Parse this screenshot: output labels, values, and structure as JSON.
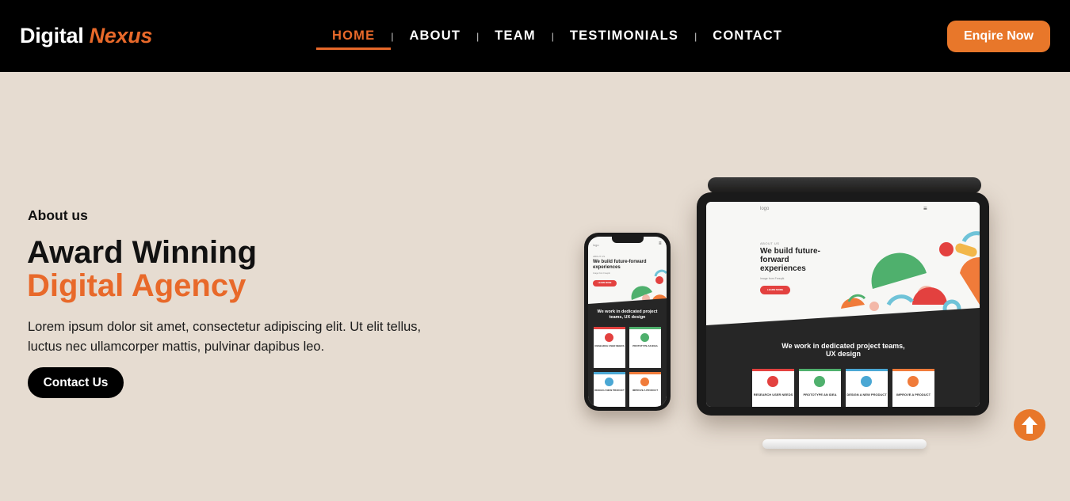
{
  "header": {
    "logo_main": "Digital",
    "logo_accent": "Nexus",
    "nav": [
      {
        "label": "HOME",
        "active": true
      },
      {
        "label": "ABOUT",
        "active": false
      },
      {
        "label": "TEAM",
        "active": false
      },
      {
        "label": "TESTIMONIALS",
        "active": false
      },
      {
        "label": "CONTACT",
        "active": false
      }
    ],
    "nav_separator": "|",
    "enquire_label": "Enqire Now"
  },
  "hero": {
    "eyebrow": "About us",
    "title_line1": "Award Winning",
    "title_line2": "Digital Agency",
    "description": "Lorem ipsum dolor sit amet, consectetur adipiscing elit. Ut elit tellus, luctus nec ullamcorper mattis, pulvinar dapibus leo.",
    "cta_label": "Contact Us"
  },
  "mockup": {
    "tablet": {
      "logo": "logo",
      "menu": "≡",
      "eyebrow": "ABOUT US",
      "headline": "We build future-forward experiences",
      "subtext": "Image from Freepik",
      "button": "LEARN MORE",
      "dark_heading": "We work in dedicated project teams, UX design",
      "cards": [
        "RESEARCH USER NEEDS",
        "PROTOTYPE AN IDEA",
        "DESIGN A NEW PRODUCT",
        "IMPROVE A PRODUCT"
      ]
    },
    "phone": {
      "logo": "logo",
      "menu": "≡",
      "eyebrow": "ABOUT US",
      "headline": "We build future-forward experiences",
      "subtext": "Image from Freepik",
      "button": "LEARN MORE",
      "dark_heading": "We work in dedicated project teams, UX design",
      "cards": [
        "RESEARCH USER NEEDS",
        "PROTOTYPE AN IDEA",
        "DESIGN A NEW PRODUCT",
        "IMPROVE A PRODUCT"
      ]
    }
  },
  "colors": {
    "accent": "#e8692a",
    "button_orange": "#e8772a",
    "header_bg": "#000000",
    "hero_bg": "#e6dcd1"
  },
  "icons": {
    "scroll_top": "arrow-up-circle-icon"
  }
}
